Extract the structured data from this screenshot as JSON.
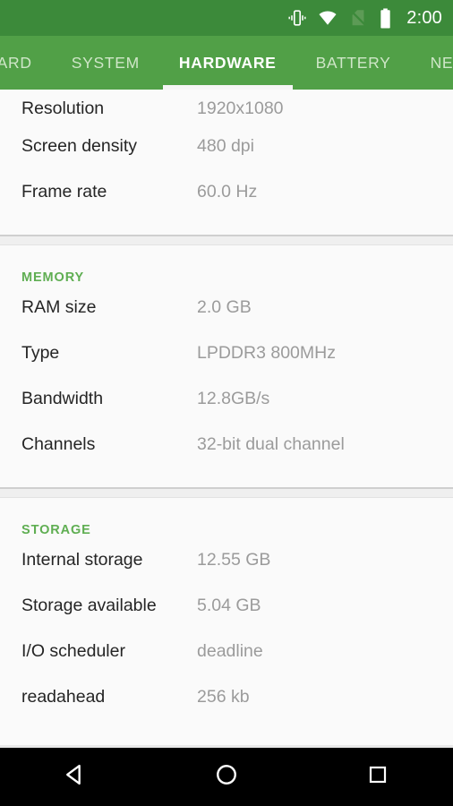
{
  "status_bar": {
    "background_color": "#3c8a3a",
    "clock": "2:00",
    "icons": [
      {
        "name": "vibrate-icon",
        "label": "vibrate"
      },
      {
        "name": "wifi-icon",
        "label": "wifi"
      },
      {
        "name": "no-sim-icon",
        "label": "no sim"
      },
      {
        "name": "battery-icon",
        "label": "battery"
      }
    ]
  },
  "tab_bar": {
    "background_color": "#51a047",
    "active_tab": "HARDWARE",
    "indicator_color": "#f5f5f5",
    "tabs": [
      {
        "label": "BOARD",
        "active": false,
        "clipped": "left"
      },
      {
        "label": "SYSTEM",
        "active": false,
        "clipped": "none"
      },
      {
        "label": "HARDWARE",
        "active": true,
        "clipped": "none"
      },
      {
        "label": "BATTERY",
        "active": false,
        "clipped": "none"
      },
      {
        "label": "NETW",
        "active": false,
        "clipped": "right"
      }
    ]
  },
  "content": {
    "accent_color": "#5fae52",
    "sections": [
      {
        "header": "",
        "show_header": false,
        "rows": [
          {
            "label": "Resolution",
            "value": "1920x1080"
          },
          {
            "label": "Screen density",
            "value": "480 dpi"
          },
          {
            "label": "Frame rate",
            "value": "60.0 Hz"
          }
        ]
      },
      {
        "header": "MEMORY",
        "show_header": true,
        "rows": [
          {
            "label": "RAM size",
            "value": "2.0 GB"
          },
          {
            "label": "Type",
            "value": "LPDDR3 800MHz"
          },
          {
            "label": "Bandwidth",
            "value": "12.8GB/s"
          },
          {
            "label": "Channels",
            "value": "32-bit dual channel"
          }
        ]
      },
      {
        "header": "STORAGE",
        "show_header": true,
        "rows": [
          {
            "label": "Internal storage",
            "value": "12.55 GB"
          },
          {
            "label": "Storage available",
            "value": "5.04 GB"
          },
          {
            "label": "I/O scheduler",
            "value": "deadline"
          },
          {
            "label": "readahead",
            "value": "256 kb"
          }
        ]
      }
    ]
  },
  "nav_bar": {
    "background_color": "#000000",
    "buttons": [
      {
        "name": "back-button",
        "icon": "back-triangle-icon"
      },
      {
        "name": "home-button",
        "icon": "home-circle-icon"
      },
      {
        "name": "recents-button",
        "icon": "recents-square-icon"
      }
    ]
  }
}
